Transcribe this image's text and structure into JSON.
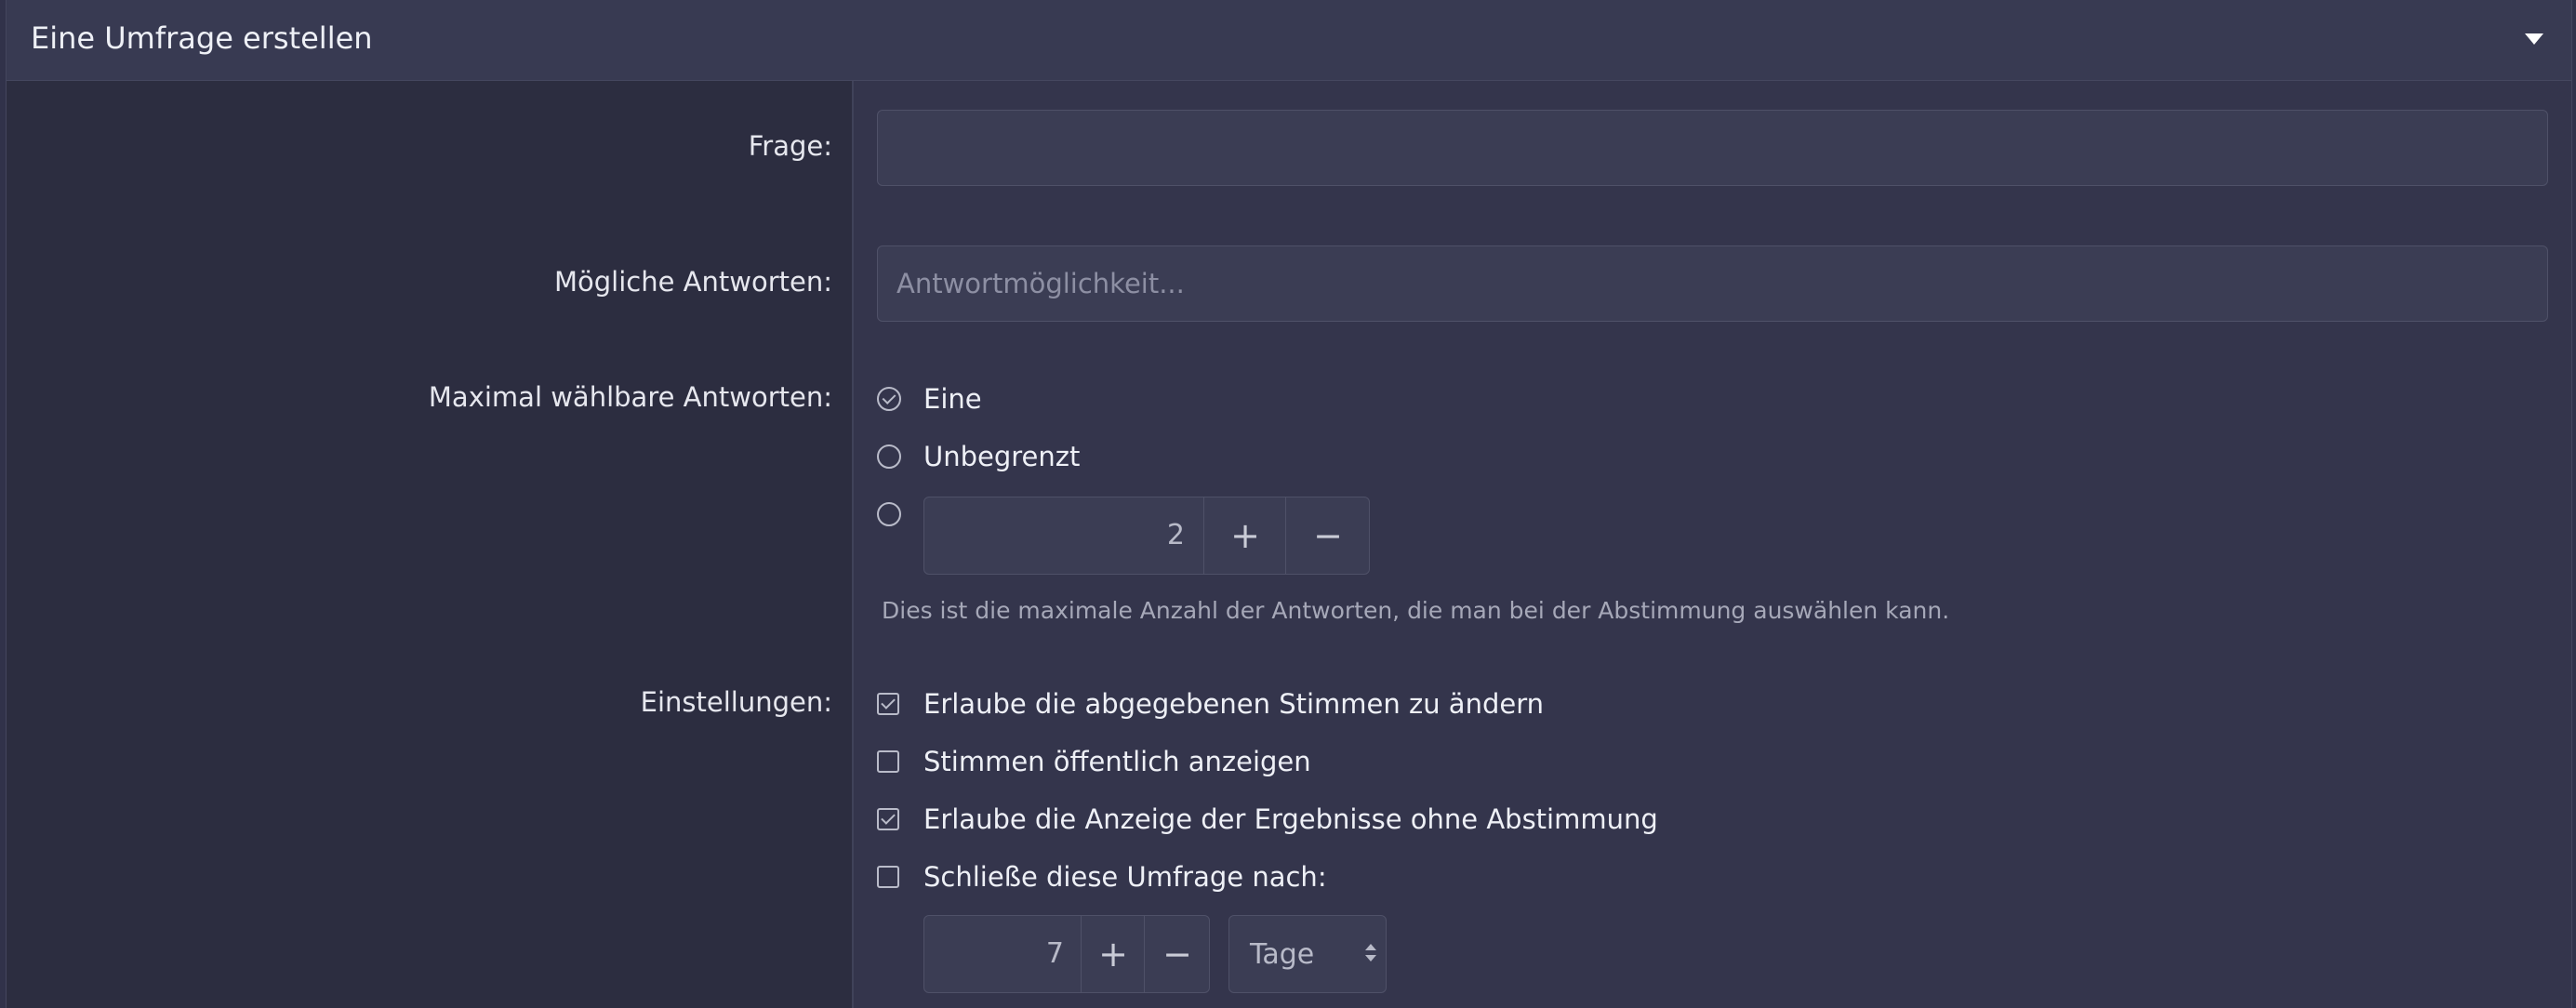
{
  "panel": {
    "title": "Eine Umfrage erstellen"
  },
  "form": {
    "question_label": "Frage:",
    "question_value": "",
    "answers_label": "Mögliche Antworten:",
    "answers_placeholder": "Antwortmöglichkeit...",
    "max_label": "Maximal wählbare Antworten:",
    "max_options": [
      {
        "label": "Eine",
        "selected": true
      },
      {
        "label": "Unbegrenzt",
        "selected": false
      }
    ],
    "max_custom_value": "2",
    "max_hint": "Dies ist die maximale Anzahl der Antworten, die man bei der Abstimmung auswählen kann.",
    "settings_label": "Einstellungen:",
    "settings": [
      {
        "label": "Erlaube die abgegebenen Stimmen zu ändern",
        "checked": true
      },
      {
        "label": "Stimmen öffentlich anzeigen",
        "checked": false
      },
      {
        "label": "Erlaube die Anzeige der Ergebnisse ohne Abstimmung",
        "checked": true
      },
      {
        "label": "Schließe diese Umfrage nach:",
        "checked": false
      }
    ],
    "close_after_value": "7",
    "close_after_unit": "Tage"
  },
  "icons": {
    "plus": "+",
    "minus": "−"
  },
  "colors": {
    "background": "#31324a",
    "label_column": "#2c2d40",
    "input": "#3b3d54"
  }
}
